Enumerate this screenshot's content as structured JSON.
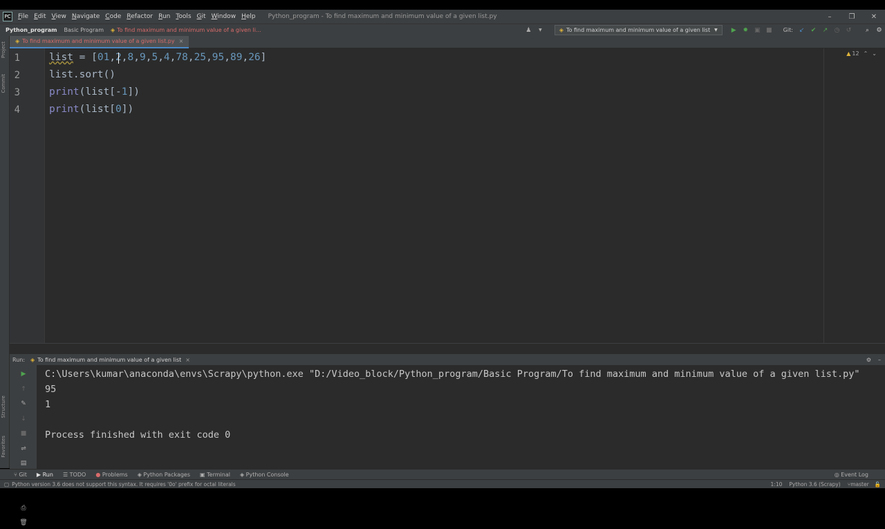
{
  "menu": [
    "File",
    "Edit",
    "View",
    "Navigate",
    "Code",
    "Refactor",
    "Run",
    "Tools",
    "Git",
    "Window",
    "Help"
  ],
  "window_title": "Python_program - To find maximum and minimum value of a given list.py",
  "window_controls": {
    "minimize": "–",
    "restore": "❐",
    "close": "✕"
  },
  "breadcrumb": {
    "project": "Python_program",
    "folder": "Basic Program",
    "file": "To find maximum and minimum value of a given li..."
  },
  "run_config": "To find maximum and minimum value of a given list",
  "git_label": "Git:",
  "editor_tab": "To find maximum and minimum value of a given list.py",
  "inspection_count": "12",
  "left_strip": {
    "project": "Project",
    "commit": "Commit",
    "structure": "Structure",
    "favorites": "Favorites"
  },
  "code_lines": [
    {
      "n": "1",
      "text": "list = [01,2,8,9,5,4,78,25,95,89,26]"
    },
    {
      "n": "2",
      "text": "list.sort()"
    },
    {
      "n": "3",
      "text": "print(list[-1])"
    },
    {
      "n": "4",
      "text": "print(list[0])"
    }
  ],
  "run_panel": {
    "label": "Run:",
    "tab": "To find maximum and minimum value of a given list"
  },
  "console_lines": [
    "C:\\Users\\kumar\\anaconda\\envs\\Scrapy\\python.exe \"D:/Video_block/Python_program/Basic Program/To find maximum and minimum value of a given list.py\"",
    "95",
    "1",
    "",
    "Process finished with exit code 0"
  ],
  "tool_windows": [
    "Git",
    "Run",
    "TODO",
    "Problems",
    "Python Packages",
    "Terminal",
    "Python Console"
  ],
  "event_log": "Event Log",
  "status": {
    "message": "Python version 3.6 does not support this syntax. It requires '0o' prefix for octal literals",
    "position": "1:10",
    "interpreter": "Python 3.6 (Scrapy)",
    "branch": "master"
  },
  "colors": {
    "editor_bg": "#2b2b2b",
    "chrome_bg": "#3c3f41",
    "number": "#6897bb",
    "builtin": "#8888c6",
    "error_text": "#d96b6b",
    "run_green": "#4fa34f"
  }
}
